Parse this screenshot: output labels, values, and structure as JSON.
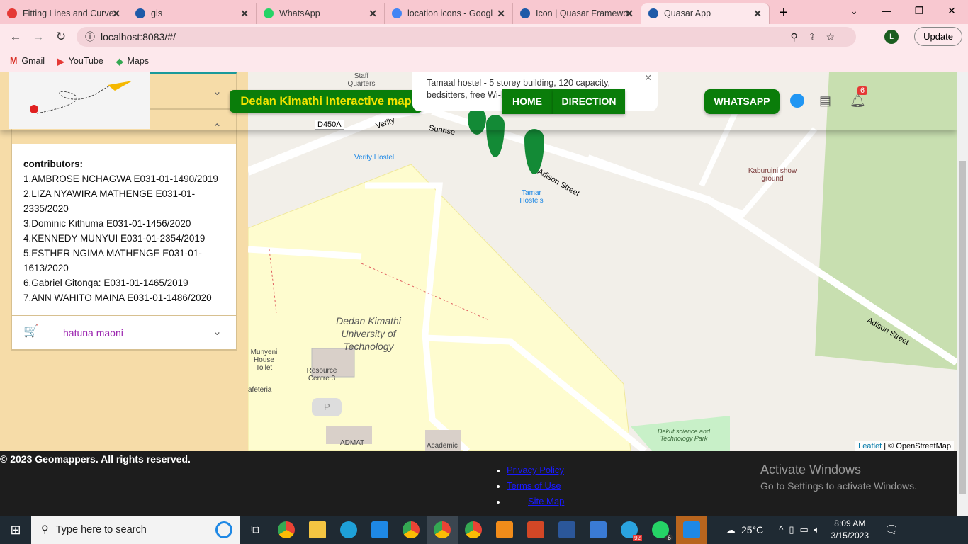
{
  "browser": {
    "tabs": [
      {
        "title": "Fitting Lines and Curve",
        "color": "#e53935"
      },
      {
        "title": "gis",
        "color": "#1e5aa8"
      },
      {
        "title": "WhatsApp",
        "color": "#25d366"
      },
      {
        "title": "location icons - Googl",
        "color": "#4285f4"
      },
      {
        "title": "Icon | Quasar Framewo",
        "color": "#1e5aa8"
      },
      {
        "title": "Quasar App",
        "color": "#1e5aa8"
      }
    ],
    "url": "localhost:8083/#/",
    "avatar": "L",
    "update": "Update",
    "bookmarks": [
      "Gmail",
      "YouTube",
      "Maps"
    ]
  },
  "header": {
    "title": "Dedan Kimathi Interactive map",
    "home": "HOME",
    "direction": "DIRECTION",
    "whatsapp": "WHATSAPP",
    "notif_count": "6"
  },
  "popup": {
    "text": "Tamaal hostel - 5 storey building, 120 capacity, bedsitters, free Wi-Fi"
  },
  "sidebar": {
    "contributors_title": "contributors:",
    "contributors": [
      "1.AMBROSE NCHAGWA E031-01-1490/2019",
      "2.LIZA NYAWIRA MATHENGE E031-01-2335/2020",
      "3.Dominic Kithuma E031-01-1456/2020",
      "4.KENNEDY MUNYUI E031-01-2354/2019",
      "5.ESTHER NGIMA MATHENGE E031-01-1613/2020",
      "6.Gabriel Gitonga: E031-01-1465/2019",
      "7.ANN WAHITO MAINA E031-01-1486/2020"
    ],
    "feedback_label": "hatuna maoni"
  },
  "map": {
    "labels": [
      "Staff Quarters",
      "D450A",
      "Verity",
      "Sunrise",
      "Verity Hostel",
      "Tamar Hostels",
      "Adison Street",
      "Kaburuini show ground",
      "Adison Street",
      "Dedan Kimathi University of Technology",
      "Munyeni House Toilet",
      "Resource Centre 3",
      "afeteria",
      "ADMAT",
      "Academic",
      "Dekut science and Technology Park",
      "P"
    ],
    "attribution_leaflet": "Leaflet",
    "attribution_osm": "| © OpenStreetMap"
  },
  "footer": {
    "copyright": "© 2023 Geomappers. All rights reserved.",
    "links": [
      "Privacy Policy",
      "Terms of Use",
      "Site Map"
    ],
    "activate_title": "Activate Windows",
    "activate_sub": "Go to Settings to activate Windows."
  },
  "taskbar": {
    "search": "Type here to search",
    "temp": "25°C",
    "time": "8:09 AM",
    "date": "3/15/2023",
    "whatsapp_badge": "6",
    "telegram_badge": "92"
  }
}
